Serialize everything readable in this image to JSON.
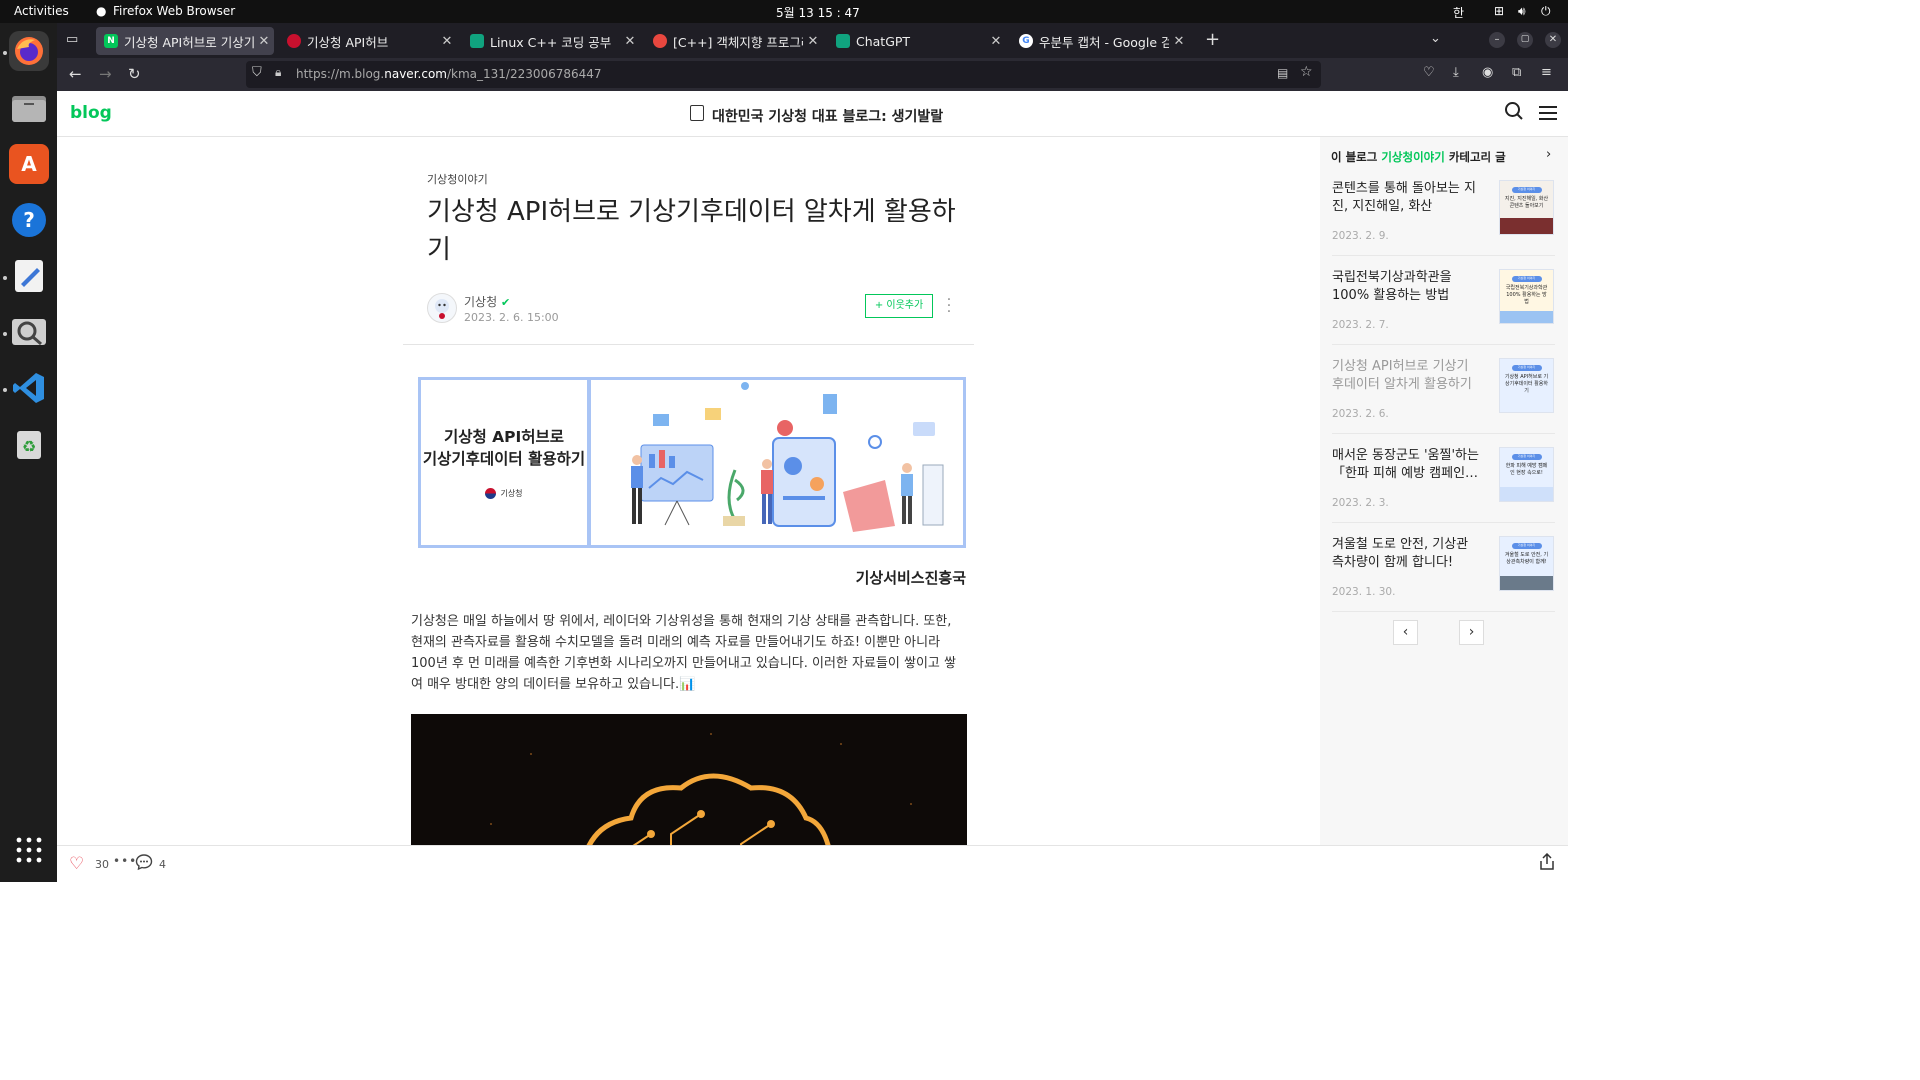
{
  "system": {
    "activities": "Activities",
    "app_name": "Firefox Web Browser",
    "clock": "5월 13  15 : 47",
    "ime": "한"
  },
  "tabs": [
    {
      "title": "기상청 API허브로 기상기후",
      "favicon_color": "#03c75a"
    },
    {
      "title": "기상청 API허브",
      "favicon_color": "#c8102e"
    },
    {
      "title": "Linux C++ 코딩 공부",
      "favicon_color": "#10a37f"
    },
    {
      "title": "[C++] 객체지향 프로그래밍",
      "favicon_color": "#e8473f"
    },
    {
      "title": "ChatGPT",
      "favicon_color": "#10a37f"
    },
    {
      "title": "우분투 캡처 - Google 검색",
      "favicon_color": "#4285f4"
    }
  ],
  "nav": {
    "url_prefix": "https://m.blog.",
    "url_domain": "naver.com",
    "url_path": "/kma_131/223006786447"
  },
  "blog": {
    "logo": "blog",
    "title": "대한민국 기상청 대표 블로그: 생기발랄"
  },
  "post": {
    "category": "기상청이야기",
    "title": "기상청 API허브로 기상기후데이터 알차게 활용하기",
    "author": "기상청",
    "date": "2023. 2. 6. 15:00",
    "follow_label": "+ 이웃추가",
    "banner_line1": "기상청 API허브로",
    "banner_line2": "기상기후데이터 활용하기",
    "banner_logo": "기상청",
    "caption": "기상서비스진흥국",
    "paragraph": "기상청은 매일 하늘에서 땅 위에서, 레이더와 기상위성을 통해 현재의 기상 상태를 관측합니다. 또한, 현재의 관측자료를 활용해 수치모델을 돌려 미래의 예측 자료를 만들어내기도 하죠! 이뿐만 아니라 100년 후 먼 미래를 예측한 기후변화 시나리오까지 만들어내고 있습니다. 이러한 자료들이 쌓이고 쌓여 매우 방대한 양의 데이터를 보유하고 있습니다.📊"
  },
  "sidebar": {
    "head_prefix": "이 블로그 ",
    "head_category": "기상청이야기",
    "head_suffix": " 카테고리 글",
    "items": [
      {
        "title": "콘텐츠를 통해 돌아보는 지진, 지진해일, 화산",
        "date": "2023. 2. 9.",
        "thumb": "지진, 지진해일, 화산 콘텐츠 돌아보기",
        "current": false
      },
      {
        "title": "국립전북기상과학관을 100% 활용하는 방법",
        "date": "2023. 2. 7.",
        "thumb": "국립전북기상과학관 100% 활용하는 방법",
        "current": false
      },
      {
        "title": "기상청 API허브로 기상기후데이터 알차게 활용하기",
        "date": "2023. 2. 6.",
        "thumb": "기상청 API허브로 기상기후데이터 활용하기",
        "current": true
      },
      {
        "title": "매서운 동장군도 '움찔'하는 「한파 피해 예방 캠페인…",
        "date": "2023. 2. 3.",
        "thumb": "한파 피해 예방 캠페인 현장 속으로!",
        "current": false
      },
      {
        "title": "겨울철 도로 안전, 기상관측차량이 함께 합니다!",
        "date": "2023. 1. 30.",
        "thumb": "겨울철 도로 안전, 기상관측차량이 함께!",
        "current": false
      }
    ],
    "thumb_header": "기상청 이야기"
  },
  "footer": {
    "likes": "30",
    "comments": "4"
  }
}
